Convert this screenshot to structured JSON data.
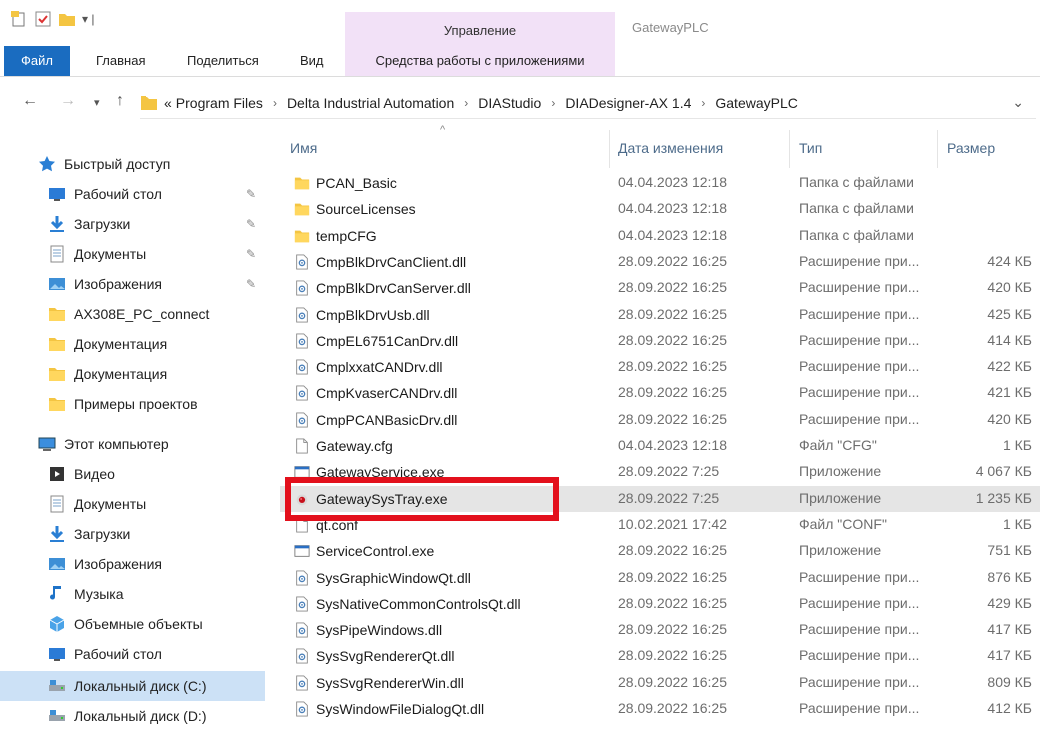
{
  "window": {
    "title": "GatewayPLC"
  },
  "ribbon": {
    "context_group": "Управление",
    "tabs": [
      "Файл",
      "Главная",
      "Поделиться",
      "Вид"
    ],
    "context_tab": "Средства работы с приложениями"
  },
  "address": {
    "overflow": "«",
    "crumbs": [
      "Program Files",
      "Delta Industrial Automation",
      "DIAStudio",
      "DIADesigner-AX 1.4",
      "GatewayPLC"
    ]
  },
  "sidebar": {
    "items": [
      {
        "label": "Быстрый доступ",
        "icon": "star-icon"
      },
      {
        "label": "Рабочий стол",
        "icon": "desktop-icon",
        "pinned": true
      },
      {
        "label": "Загрузки",
        "icon": "download-icon",
        "pinned": true
      },
      {
        "label": "Документы",
        "icon": "documents-icon",
        "pinned": true
      },
      {
        "label": "Изображения",
        "icon": "pictures-icon",
        "pinned": true
      },
      {
        "label": "AX308E_PC_connect",
        "icon": "folder-icon"
      },
      {
        "label": "Документация",
        "icon": "folder-icon"
      },
      {
        "label": "Документация",
        "icon": "folder-icon"
      },
      {
        "label": "Примеры проектов",
        "icon": "folder-icon"
      },
      {
        "label": "Этот компьютер",
        "icon": "computer-icon"
      },
      {
        "label": "Видео",
        "icon": "video-icon"
      },
      {
        "label": "Документы",
        "icon": "documents-icon"
      },
      {
        "label": "Загрузки",
        "icon": "download-icon"
      },
      {
        "label": "Изображения",
        "icon": "pictures-icon"
      },
      {
        "label": "Музыка",
        "icon": "music-icon"
      },
      {
        "label": "Объемные объекты",
        "icon": "3d-objects-icon"
      },
      {
        "label": "Рабочий стол",
        "icon": "desktop-icon"
      },
      {
        "label": "Локальный диск (C:)",
        "icon": "drive-icon",
        "selected": true
      },
      {
        "label": "Локальный диск (D:)",
        "icon": "drive-icon"
      }
    ]
  },
  "columns": {
    "name": "Имя",
    "date": "Дата изменения",
    "type": "Тип",
    "size": "Размер"
  },
  "files": [
    {
      "name": "PCAN_Basic",
      "date": "04.04.2023 12:18",
      "type": "Папка с файлами",
      "size": "",
      "icon": "folder-icon"
    },
    {
      "name": "SourceLicenses",
      "date": "04.04.2023 12:18",
      "type": "Папка с файлами",
      "size": "",
      "icon": "folder-icon"
    },
    {
      "name": "tempCFG",
      "date": "04.04.2023 12:18",
      "type": "Папка с файлами",
      "size": "",
      "icon": "folder-icon"
    },
    {
      "name": "CmpBlkDrvCanClient.dll",
      "date": "28.09.2022 16:25",
      "type": "Расширение при...",
      "size": "424 КБ",
      "icon": "dll-icon"
    },
    {
      "name": "CmpBlkDrvCanServer.dll",
      "date": "28.09.2022 16:25",
      "type": "Расширение при...",
      "size": "420 КБ",
      "icon": "dll-icon"
    },
    {
      "name": "CmpBlkDrvUsb.dll",
      "date": "28.09.2022 16:25",
      "type": "Расширение при...",
      "size": "425 КБ",
      "icon": "dll-icon"
    },
    {
      "name": "CmpEL6751CanDrv.dll",
      "date": "28.09.2022 16:25",
      "type": "Расширение при...",
      "size": "414 КБ",
      "icon": "dll-icon"
    },
    {
      "name": "CmplxxatCANDrv.dll",
      "date": "28.09.2022 16:25",
      "type": "Расширение при...",
      "size": "422 КБ",
      "icon": "dll-icon"
    },
    {
      "name": "CmpKvaserCANDrv.dll",
      "date": "28.09.2022 16:25",
      "type": "Расширение при...",
      "size": "421 КБ",
      "icon": "dll-icon"
    },
    {
      "name": "CmpPCANBasicDrv.dll",
      "date": "28.09.2022 16:25",
      "type": "Расширение при...",
      "size": "420 КБ",
      "icon": "dll-icon"
    },
    {
      "name": "Gateway.cfg",
      "date": "04.04.2023 12:18",
      "type": "Файл \"CFG\"",
      "size": "1 КБ",
      "icon": "file-icon"
    },
    {
      "name": "GatewayService.exe",
      "date": "28.09.2022 7:25",
      "type": "Приложение",
      "size": "4 067 КБ",
      "icon": "exe-icon"
    },
    {
      "name": "GatewaySysTray.exe",
      "date": "28.09.2022 7:25",
      "type": "Приложение",
      "size": "1 235 КБ",
      "icon": "systray-exe-icon",
      "selected": true
    },
    {
      "name": "qt.conf",
      "date": "10.02.2021 17:42",
      "type": "Файл \"CONF\"",
      "size": "1 КБ",
      "icon": "file-icon"
    },
    {
      "name": "ServiceControl.exe",
      "date": "28.09.2022 16:25",
      "type": "Приложение",
      "size": "751 КБ",
      "icon": "exe-icon"
    },
    {
      "name": "SysGraphicWindowQt.dll",
      "date": "28.09.2022 16:25",
      "type": "Расширение при...",
      "size": "876 КБ",
      "icon": "dll-icon"
    },
    {
      "name": "SysNativeCommonControlsQt.dll",
      "date": "28.09.2022 16:25",
      "type": "Расширение при...",
      "size": "429 КБ",
      "icon": "dll-icon"
    },
    {
      "name": "SysPipeWindows.dll",
      "date": "28.09.2022 16:25",
      "type": "Расширение при...",
      "size": "417 КБ",
      "icon": "dll-icon"
    },
    {
      "name": "SysSvgRendererQt.dll",
      "date": "28.09.2022 16:25",
      "type": "Расширение при...",
      "size": "417 КБ",
      "icon": "dll-icon"
    },
    {
      "name": "SysSvgRendererWin.dll",
      "date": "28.09.2022 16:25",
      "type": "Расширение при...",
      "size": "809 КБ",
      "icon": "dll-icon"
    },
    {
      "name": "SysWindowFileDialogQt.dll",
      "date": "28.09.2022 16:25",
      "type": "Расширение при...",
      "size": "412 КБ",
      "icon": "dll-icon"
    }
  ],
  "colors": {
    "file_tab": "#1a6cc0",
    "context_tab": "#f2e1f7",
    "highlight_box": "#e3101c",
    "selected_row": "#e5e5e5",
    "sidebar_selected": "#cce1f6",
    "folder": "#f4c542"
  }
}
